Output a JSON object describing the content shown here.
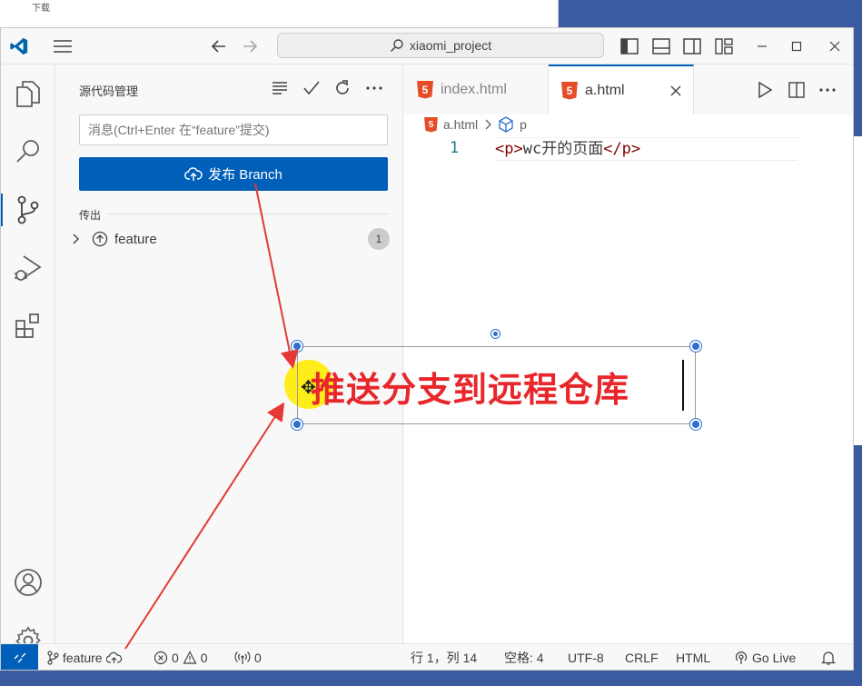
{
  "titlebar": {
    "search_text": "xiaomi_project"
  },
  "background": {
    "ghost_text": "下载"
  },
  "sidebar": {
    "title": "源代码管理",
    "commit_placeholder": "消息(Ctrl+Enter 在“feature”提交)",
    "publish_label": "发布 Branch",
    "section_label": "传出",
    "outgoing_branch": "feature",
    "outgoing_count": "1"
  },
  "editor": {
    "tabs": [
      {
        "label": "index.html",
        "active": false
      },
      {
        "label": "a.html",
        "active": true
      }
    ],
    "html5_glyph": "5",
    "breadcrumb": {
      "file": "a.html",
      "symbol": "p"
    },
    "lines": [
      {
        "number": "1",
        "open_tag": "<p>",
        "text": "wc开的页面",
        "close_tag": "</p>"
      }
    ]
  },
  "statusbar": {
    "branch": "feature",
    "errors": "0",
    "warnings": "0",
    "ports": "0",
    "position": "行 1，列 14",
    "spaces": "空格: 4",
    "encoding": "UTF-8",
    "eol": "CRLF",
    "language": "HTML",
    "golive": "Go Live"
  },
  "annotation": {
    "text": "推送分支到远程仓库",
    "color": "#e8262b"
  },
  "colors": {
    "accent": "#005fb8",
    "arrow": "#e53935"
  }
}
